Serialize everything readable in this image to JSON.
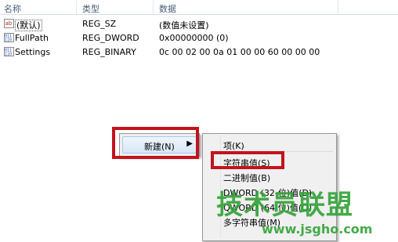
{
  "columns": {
    "name": "名称",
    "type": "类型",
    "data": "数据"
  },
  "rows": [
    {
      "icon": "string-value-icon",
      "name": "(默认)",
      "type": "REG_SZ",
      "data": "(数值未设置)"
    },
    {
      "icon": "binary-value-icon",
      "name": "FullPath",
      "type": "REG_DWORD",
      "data": "0x00000000 (0)"
    },
    {
      "icon": "binary-value-icon",
      "name": "Settings",
      "type": "REG_BINARY",
      "data": "0c 00 02 00 0a 01 00 00 60 00 00 00"
    }
  ],
  "context_menu": {
    "new_label": "新建(N)",
    "arrow": "▶"
  },
  "submenu": {
    "items": [
      "项(K)",
      "字符串值(S)",
      "二进制值(B)",
      "DWORD (32-位)值(D)",
      "QWORD (64 位)值(Q)",
      "多字符串值(M)"
    ]
  },
  "watermark": {
    "text": "技术员联盟",
    "url": "www.jsgho.com"
  },
  "colors": {
    "highlight_box": "#c3131e",
    "watermark": "#35a43a",
    "menu_bg": "#f0f0f0"
  }
}
